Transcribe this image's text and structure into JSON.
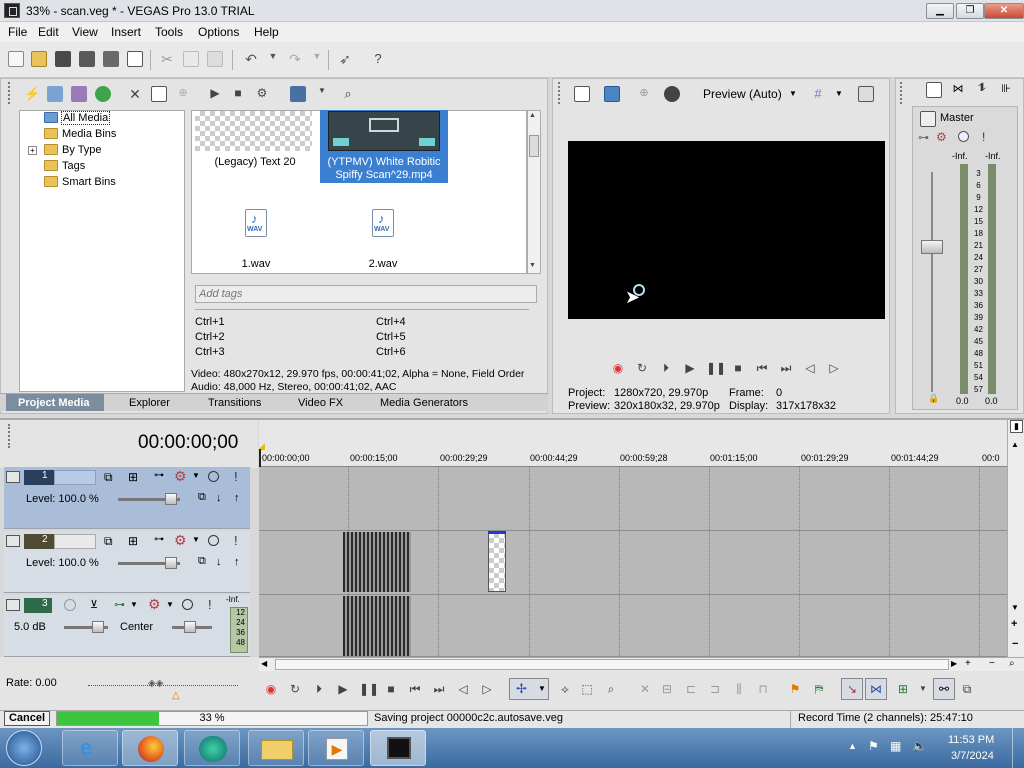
{
  "window": {
    "title": "33% - scan.veg * - VEGAS Pro 13.0 TRIAL"
  },
  "menu": [
    "File",
    "Edit",
    "View",
    "Insert",
    "Tools",
    "Options",
    "Help"
  ],
  "media_tree": {
    "items": [
      "All Media",
      "Media Bins",
      "By Type",
      "Tags",
      "Smart Bins"
    ],
    "expand": "+"
  },
  "media_items": {
    "legacy_text": "(Legacy) Text 20",
    "video_line1": "(YTPMV) White Robitic",
    "video_line2": "Spiffy Scan^29.mp4",
    "wav1": "1.wav",
    "wav2": "2.wav"
  },
  "tags": {
    "placeholder": "Add tags",
    "shortcuts_left": [
      "Ctrl+1",
      "Ctrl+2",
      "Ctrl+3"
    ],
    "shortcuts_right": [
      "Ctrl+4",
      "Ctrl+5",
      "Ctrl+6"
    ]
  },
  "media_info": {
    "video": "Video: 480x270x12, 29.970 fps, 00:00:41;02, Alpha = None, Field Order",
    "audio": "Audio: 48,000 Hz, Stereo, 00:00:41;02, AAC"
  },
  "panel_tabs": [
    "Project Media",
    "Explorer",
    "Transitions",
    "Video FX",
    "Media Generators"
  ],
  "preview": {
    "mode": "Preview (Auto)",
    "project_label": "Project:",
    "project_value": "1280x720, 29.970p",
    "preview_label": "Preview:",
    "preview_value": "320x180x32, 29.970p",
    "frame_label": "Frame:",
    "frame_value": "0",
    "display_label": "Display:",
    "display_value": "317x178x32"
  },
  "mixer": {
    "title": "Master",
    "inf_left": "-Inf.",
    "inf_right": "-Inf.",
    "scale": [
      "3",
      "6",
      "9",
      "12",
      "15",
      "18",
      "21",
      "24",
      "27",
      "30",
      "33",
      "36",
      "39",
      "42",
      "45",
      "48",
      "51",
      "54",
      "57"
    ],
    "bottom_left": "0.0",
    "bottom_right": "0.0"
  },
  "timeline": {
    "timecode": "00:00:00;00",
    "ruler": [
      "00:00:00;00",
      "00:00:15;00",
      "00:00:29;29",
      "00:00:44;29",
      "00:00:59;28",
      "00:01:15;00",
      "00:01:29;29",
      "00:01:44;29",
      "00:0"
    ],
    "tracks": [
      {
        "num": "1",
        "level": "Level: 100.0 %"
      },
      {
        "num": "2",
        "level": "Level: 100.0 %"
      },
      {
        "num": "3",
        "volume": "5.0 dB",
        "pan": "Center",
        "inf": "-Inf.",
        "meter": [
          "12",
          "24",
          "36",
          "48"
        ]
      }
    ],
    "rate": "Rate: 0.00"
  },
  "status": {
    "cancel": "Cancel",
    "progress_percent": 33,
    "progress_text": "33 %",
    "saving": "Saving project 00000c2c.autosave.veg",
    "record_time": "Record Time (2 channels): 25:47:10"
  },
  "taskbar": {
    "time": "11:53 PM",
    "date": "3/7/2024"
  },
  "colors": {
    "progress": "#3ec43e",
    "selected_track": "#a9bdd8",
    "taskbar": "#3a6aa0"
  }
}
